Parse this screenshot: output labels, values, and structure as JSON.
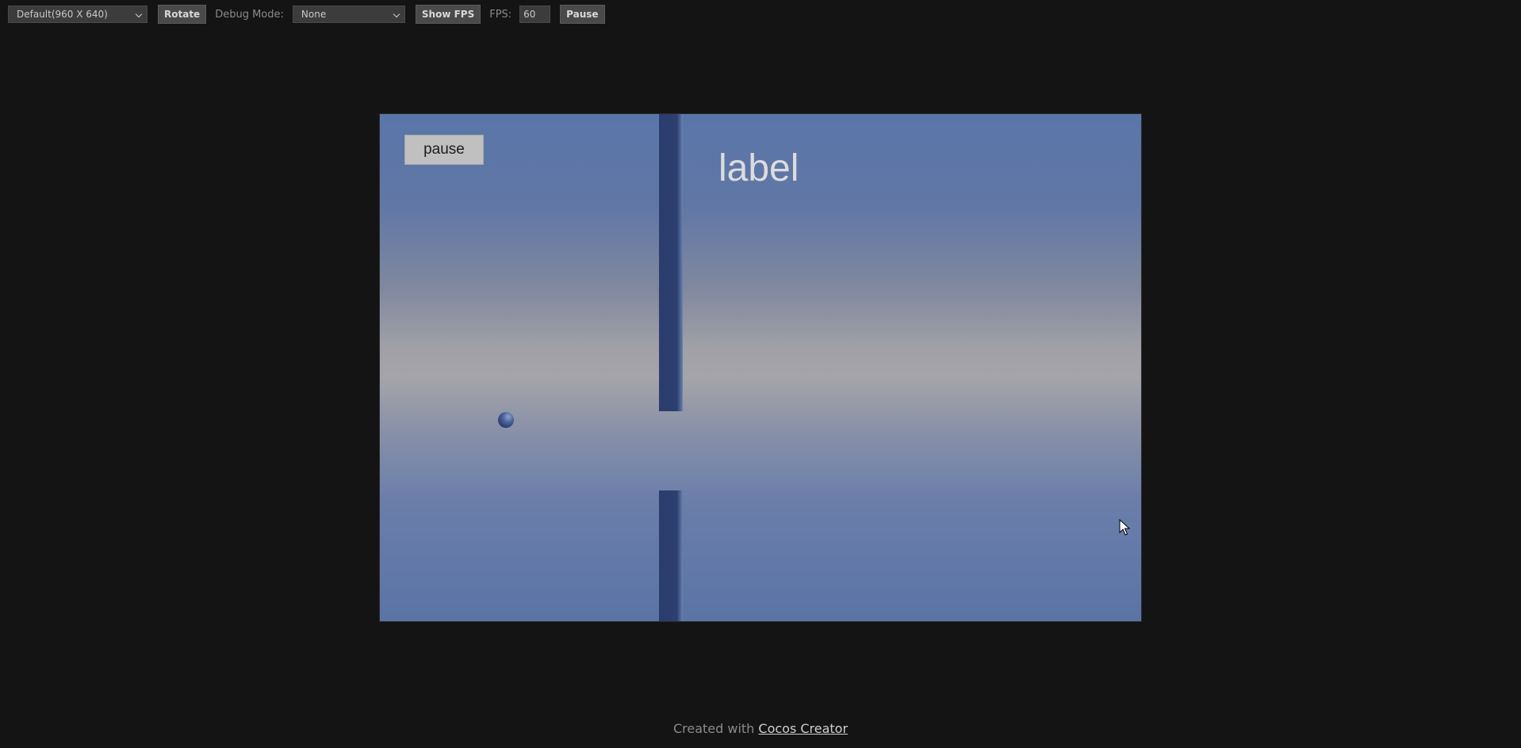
{
  "toolbar": {
    "resolution_value": "Default(960 X 640)",
    "rotate_label": "Rotate",
    "debug_mode_label": "Debug Mode:",
    "debug_mode_value": "None",
    "show_fps_label": "Show FPS",
    "fps_label": "FPS:",
    "fps_value": "60",
    "pause_label": "Pause"
  },
  "game": {
    "pause_button_label": "pause",
    "score_label": "label"
  },
  "footer": {
    "prefix": "Created with ",
    "link_text": "Cocos Creator"
  },
  "icons": {
    "dropdown": "chevron-down-icon",
    "cursor": "mouse-pointer-icon"
  },
  "colors": {
    "page_background": "#141414",
    "sky_top": "#5a76a8",
    "sky_mid": "#a5a5a9",
    "pipe": "#2c3f70",
    "ball": "#4a6097"
  }
}
